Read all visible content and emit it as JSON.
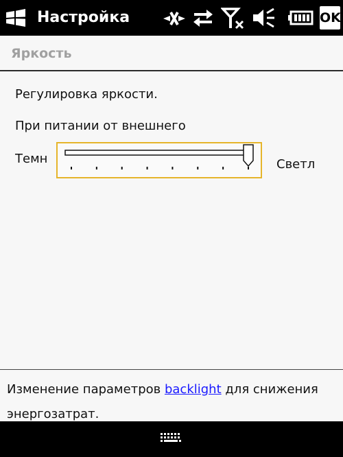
{
  "titlebar": {
    "title": "Настройка",
    "ok_label": "OK",
    "icons": [
      "windows-start-icon",
      "data-disconnected-icon",
      "sync-arrows-icon",
      "no-signal-icon",
      "volume-muted-icon",
      "battery-icon"
    ]
  },
  "section": {
    "title": "Яркость"
  },
  "content": {
    "heading": "Регулировка яркости.",
    "power_source": "При питании от внешнего",
    "slider": {
      "min_label": "Темн",
      "max_label": "Светл",
      "value_fraction": 1.0,
      "tick_count": 8
    }
  },
  "footer": {
    "hint_before": "Изменение параметров ",
    "hint_link": "backlight",
    "hint_after": " для снижения энергозатрат."
  },
  "softkeys": {
    "center_icon": "keyboard-icon"
  },
  "colors": {
    "accent_focus": "#e6b52a",
    "link": "#1a1aff",
    "bar_background": "#000000"
  }
}
